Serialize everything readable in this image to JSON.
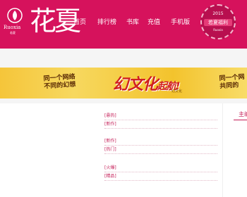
{
  "header": {
    "brand": "花夏",
    "logo_text": "Ruoxia",
    "logo_sub": "若夏",
    "nav": [
      "首页",
      "排行榜",
      "书库",
      "充值",
      "手机版"
    ]
  },
  "badge": {
    "year": "2015",
    "name": "若夏福利",
    "mark": "Ruoxia"
  },
  "banner": {
    "left_line1": "同一个网络",
    "left_line2": "不同的幻想",
    "main": "幻文化",
    "main_tail": "起航!",
    "tag": "幻文化",
    "right_line1": "同一个网",
    "right_line2": "共同的"
  },
  "content": {
    "groups": [
      [
        "[悬热]",
        "[新作]"
      ],
      [
        "[新作]",
        "[热门]"
      ],
      [
        "[火爆]",
        "[精品]"
      ]
    ],
    "side_title": "主编"
  },
  "colors": {
    "header": "#d6125c",
    "accent": "#c41b55",
    "banner": "#f5c53a"
  }
}
